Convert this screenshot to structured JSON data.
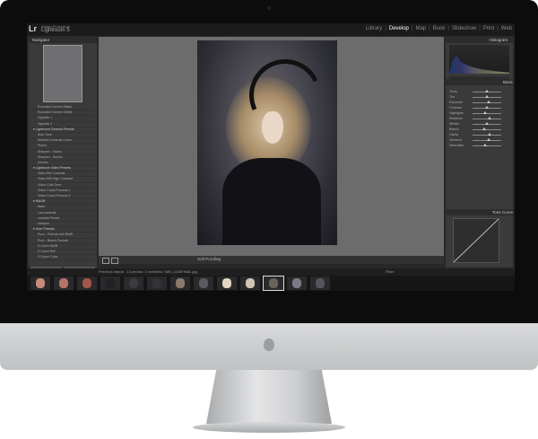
{
  "app": {
    "logo": "Lr",
    "subtitle": "Adobe Photoshop",
    "name": "Lightroom 5"
  },
  "modules": [
    "Library",
    "Develop",
    "Map",
    "Book",
    "Slideshow",
    "Print",
    "Web"
  ],
  "active_module": "Develop",
  "left_panel": {
    "navigator_label": "Navigator",
    "presets": [
      {
        "label": "Rounded Corners Black",
        "folder": false
      },
      {
        "label": "Rounded Corners White",
        "folder": false
      },
      {
        "label": "Vignette 1",
        "folder": false
      },
      {
        "label": "Vignette 2",
        "folder": false
      },
      {
        "label": "Lightroom General Presets",
        "folder": true
      },
      {
        "label": "Auto Tone",
        "folder": false
      },
      {
        "label": "Medium Contrast Curve",
        "folder": false
      },
      {
        "label": "Punch",
        "folder": false
      },
      {
        "label": "Sharpen - Faces",
        "folder": false
      },
      {
        "label": "Sharpen - Scenic",
        "folder": false
      },
      {
        "label": "Zeroed",
        "folder": false
      },
      {
        "label": "Lightroom Video Presets",
        "folder": true
      },
      {
        "label": "Video BW Contrast",
        "folder": false
      },
      {
        "label": "Video BW High Contrast",
        "folder": false
      },
      {
        "label": "Video Cold Tone",
        "folder": false
      },
      {
        "label": "Video Cross Process 1",
        "folder": false
      },
      {
        "label": "Video Cross Process 2",
        "folder": false
      },
      {
        "label": "MAGB",
        "folder": true
      },
      {
        "label": "Base",
        "folder": false
      },
      {
        "label": "Low contrast",
        "folder": false
      },
      {
        "label": "contrast Preset",
        "folder": false
      },
      {
        "label": "sharpen",
        "folder": false
      },
      {
        "label": "User Presets",
        "folder": true
      },
      {
        "label": "Pure - Portrait with BWB",
        "folder": false
      },
      {
        "label": "Pure - Beach Portrait",
        "folder": false
      },
      {
        "label": "S Curve BWB",
        "folder": false
      },
      {
        "label": "S Curve BW",
        "folder": false
      },
      {
        "label": "S Curve Color",
        "folder": false
      }
    ],
    "copy_label": "Copy...",
    "paste_label": "Paste"
  },
  "toolbar": {
    "soft_proofing": "Soft Proofing"
  },
  "right_panel": {
    "histogram_label": "Histogram",
    "basic_label": "Basic",
    "tone_curve_label": "Tone Curve",
    "previous_label": "Previous",
    "reset_label": "Reset",
    "sliders": [
      {
        "label": "Temp",
        "value": 0.5
      },
      {
        "label": "Tint",
        "value": 0.5
      },
      {
        "label": "Exposure",
        "value": 0.55
      },
      {
        "label": "Contrast",
        "value": 0.5
      },
      {
        "label": "Highlights",
        "value": 0.45
      },
      {
        "label": "Shadows",
        "value": 0.6
      },
      {
        "label": "Whites",
        "value": 0.5
      },
      {
        "label": "Blacks",
        "value": 0.4
      },
      {
        "label": "Clarity",
        "value": 0.6
      },
      {
        "label": "Vibrance",
        "value": 0.55
      },
      {
        "label": "Saturation",
        "value": 0.45
      }
    ]
  },
  "filmstrip": {
    "source": "Previous Import",
    "count_text": "13 photos / 1 selected / IMG_1163FINAL.jpg",
    "filter_label": "Filter:",
    "thumbs": [
      "#c98a7a",
      "#b67468",
      "#a2564c",
      "#222226",
      "#3a3a40",
      "#333338",
      "#8a7a6a",
      "#5a5a60",
      "#e5d6c0",
      "#cfc5b2",
      "#6a6258",
      "#7a7a86",
      "#555561"
    ]
  },
  "colors": {
    "bezel": "#0c0c0d",
    "panel": "#3a3a3b",
    "canvas": "#6c6c6d"
  }
}
